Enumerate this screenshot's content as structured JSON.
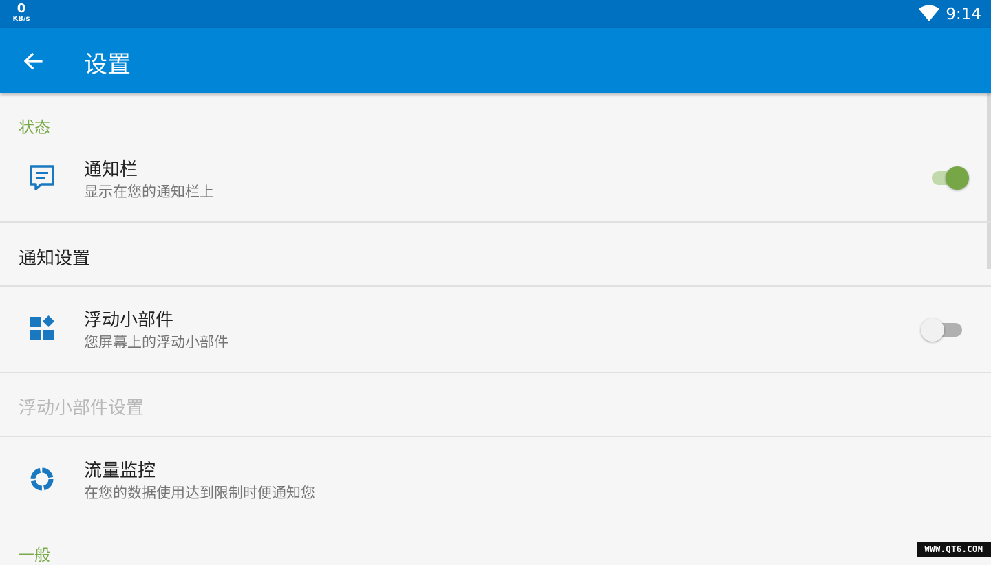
{
  "status_bar": {
    "net_speed": "0",
    "net_unit": "KB/s",
    "time": "9:14"
  },
  "app_bar": {
    "title": "设置"
  },
  "sections": {
    "status": {
      "header": "状态"
    },
    "general": {
      "header": "一般"
    }
  },
  "items": {
    "notification_bar": {
      "title": "通知栏",
      "subtitle": "显示在您的通知栏上",
      "enabled": true
    },
    "notification_settings": {
      "label": "通知设置"
    },
    "floating_widget": {
      "title": "浮动小部件",
      "subtitle": "您屏幕上的浮动小部件",
      "enabled": false
    },
    "floating_widget_settings": {
      "label": "浮动小部件设置"
    },
    "traffic_monitor": {
      "title": "流量监控",
      "subtitle": "在您的数据使用达到限制时便通知您"
    }
  },
  "watermark": "WWW.QT6.COM",
  "colors": {
    "status_bar": "#0070c0",
    "app_bar": "#0185d6",
    "accent": "#7aaa4a",
    "icon": "#1a78c0"
  }
}
